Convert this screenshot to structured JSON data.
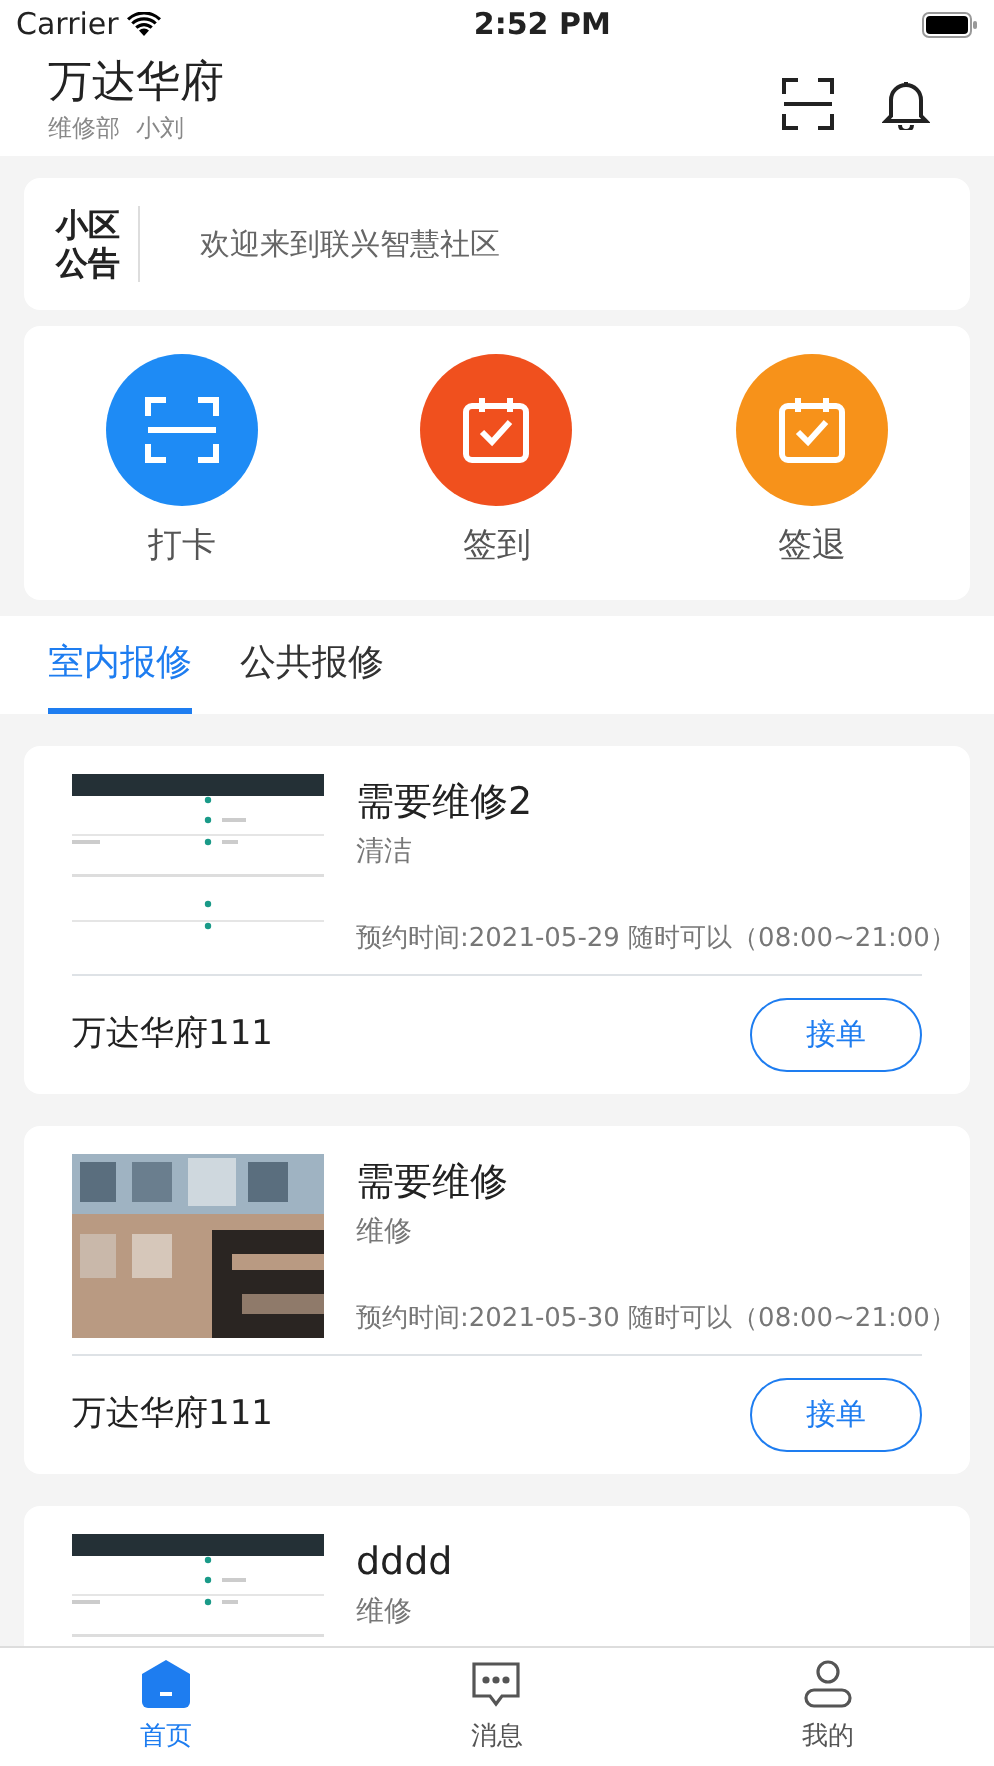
{
  "status_bar": {
    "carrier": "Carrier",
    "time": "2:52 PM"
  },
  "header": {
    "title": "万达华府",
    "department": "维修部",
    "user": "小刘"
  },
  "notice": {
    "label": "小区公告",
    "text": "欢迎来到联兴智慧社区"
  },
  "actions": [
    {
      "label": "打卡",
      "kind": "scan",
      "color": "#1e8bf5"
    },
    {
      "label": "签到",
      "kind": "calendar",
      "color": "#f0501e"
    },
    {
      "label": "签退",
      "kind": "calendar",
      "color": "#f7921a"
    }
  ],
  "tabs": [
    {
      "label": "室内报修",
      "selected": true
    },
    {
      "label": "公共报修",
      "selected": false
    }
  ],
  "orders": [
    {
      "title": "需要维修2",
      "category": "清洁",
      "time": "预约时间:2021-05-29 随时可以（08:00~21:00）",
      "address": "万达华府111",
      "button": "接单"
    },
    {
      "title": "需要维修",
      "category": "维修",
      "time": "预约时间:2021-05-30 随时可以（08:00~21:00）",
      "address": "万达华府111",
      "button": "接单"
    },
    {
      "title": "dddd",
      "category": "维修"
    }
  ],
  "tab_bar": [
    {
      "label": "首页",
      "kind": "home",
      "selected": true
    },
    {
      "label": "消息",
      "kind": "message",
      "selected": false
    },
    {
      "label": "我的",
      "kind": "profile",
      "selected": false
    }
  ]
}
